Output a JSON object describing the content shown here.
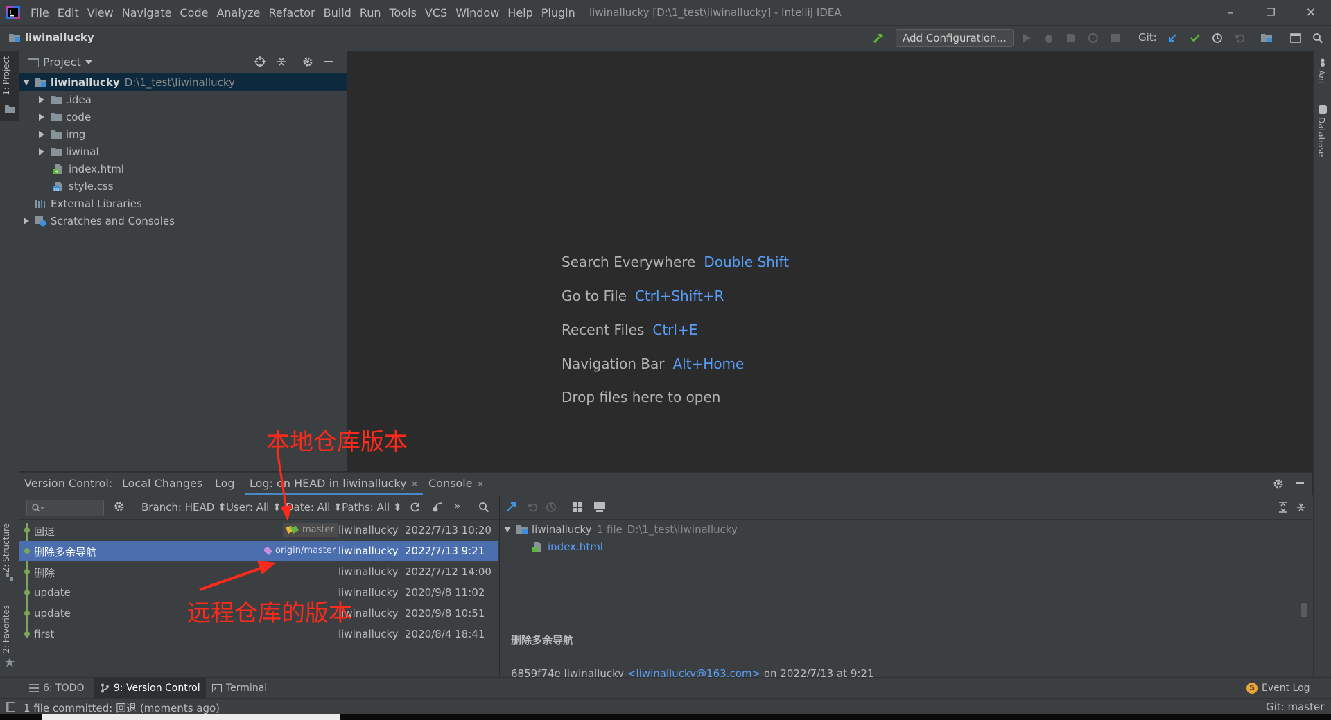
{
  "window": {
    "title": "liwinallucky [D:\\1_test\\liwinallucky] - IntelliJ IDEA",
    "menu": [
      "File",
      "Edit",
      "View",
      "Navigate",
      "Code",
      "Analyze",
      "Refactor",
      "Build",
      "Run",
      "Tools",
      "VCS",
      "Window",
      "Help",
      "Plugin"
    ],
    "controls": {
      "minimize": "–",
      "maximize": "❐",
      "close": "✕"
    }
  },
  "navbar": {
    "project_name": "liwinallucky",
    "add_config_label": "Add Configuration...",
    "git_label": "Git:"
  },
  "left_stripe": {
    "project_tab": "1: Project",
    "structure_tab": "Z: Structure",
    "favorites_tab": "2: Favorites"
  },
  "right_stripe": {
    "ant_tab": "Ant",
    "database_tab": "Database"
  },
  "project_panel": {
    "title": "Project",
    "tree": [
      {
        "name": "liwinallucky",
        "path": "D:\\1_test\\liwinallucky",
        "type": "module"
      },
      {
        "name": ".idea",
        "type": "folder"
      },
      {
        "name": "code",
        "type": "folder"
      },
      {
        "name": "img",
        "type": "folder"
      },
      {
        "name": "liwinal",
        "type": "folder"
      },
      {
        "name": "index.html",
        "type": "html"
      },
      {
        "name": "style.css",
        "type": "css"
      },
      {
        "name": "External Libraries",
        "type": "libraries"
      },
      {
        "name": "Scratches and Consoles",
        "type": "scratches"
      }
    ]
  },
  "editor_hints": [
    {
      "label": "Search Everywhere",
      "key": "Double Shift"
    },
    {
      "label": "Go to File",
      "key": "Ctrl+Shift+R"
    },
    {
      "label": "Recent Files",
      "key": "Ctrl+E"
    },
    {
      "label": "Navigation Bar",
      "key": "Alt+Home"
    },
    {
      "label": "Drop files here to open",
      "key": ""
    }
  ],
  "version_control": {
    "label": "Version Control:",
    "tabs": [
      "Local Changes",
      "Log",
      "Log: on HEAD in liwinallucky",
      "Console"
    ],
    "filters": {
      "branch": "Branch: HEAD",
      "user": "User: All",
      "date": "Date: All",
      "paths": "Paths: All"
    },
    "commits": [
      {
        "message": "回退",
        "ref": "master",
        "author": "liwinallucky",
        "date": "2022/7/13 10:20"
      },
      {
        "message": "删除多余导航",
        "ref": "origin/master",
        "author": "liwinallucky",
        "date": "2022/7/13 9:21"
      },
      {
        "message": "删除",
        "ref": "",
        "author": "liwinallucky",
        "date": "2022/7/12 14:00"
      },
      {
        "message": "update",
        "ref": "",
        "author": "liwinallucky",
        "date": "2020/9/8 11:02"
      },
      {
        "message": "update",
        "ref": "",
        "author": "liwinallucky",
        "date": "2020/9/8 10:51"
      },
      {
        "message": "first",
        "ref": "",
        "author": "liwinallucky",
        "date": "2020/8/4 18:41"
      }
    ],
    "changes": {
      "root": "liwinallucky",
      "count": "1 file",
      "path": "D:\\1_test\\liwinallucky",
      "file": "index.html"
    },
    "details": {
      "subject": "删除多余导航",
      "hash_author": "6859f74e liwinallucky",
      "email": "<liwinallucky@163.com>",
      "on_date": "on 2022/7/13 at 9:21"
    }
  },
  "bottom_tabs": [
    {
      "num": "6",
      "label": ": TODO"
    },
    {
      "num": "9",
      "label": ": Version Control"
    },
    {
      "num": "",
      "label": "Terminal"
    }
  ],
  "event_log": {
    "badge": "5",
    "label": "Event Log"
  },
  "status": {
    "message": "1 file committed: 回退 (moments ago)",
    "git_branch": "Git: master"
  },
  "annotations": {
    "local": "本地仓库版本",
    "remote": "远程仓库的版本"
  },
  "colors": {
    "accent": "#4a88c7",
    "selection": "#4b6eaf",
    "link": "#589df6",
    "annotation": "#ff2a1a",
    "graph": "#7ea35b"
  }
}
